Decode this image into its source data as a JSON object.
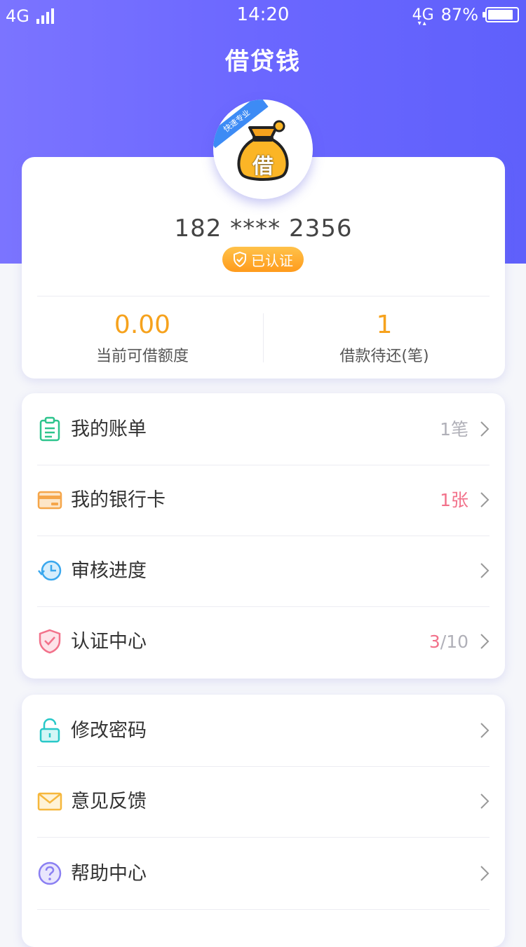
{
  "status_bar": {
    "network_left": "4G",
    "time": "14:20",
    "network_right": "4G",
    "battery": "87%",
    "battery_level": 0.87
  },
  "header": {
    "title": "借贷钱"
  },
  "profile": {
    "avatar_ribbon": "快速专业",
    "avatar_icon": "money-bag-icon",
    "avatar_char": "借",
    "phone": "182 **** 2356",
    "verified_label": "已认证",
    "stats": [
      {
        "value": "0.00",
        "label": "当前可借额度"
      },
      {
        "value": "1",
        "label": "借款待还(笔)"
      }
    ]
  },
  "menu_group_1": [
    {
      "label": "我的账单",
      "value": "1笔",
      "icon": "clipboard-icon",
      "color": "#2dc48d"
    },
    {
      "label": "我的银行卡",
      "value": "1张",
      "icon": "bank-card-icon",
      "color": "#f5a64a"
    },
    {
      "label": "审核进度",
      "value": "",
      "icon": "clock-progress-icon",
      "color": "#3aa8ee"
    },
    {
      "label": "认证中心",
      "value_done": "3",
      "value_total": "/10",
      "icon": "shield-check-icon",
      "color": "#f2718a"
    }
  ],
  "menu_group_2": [
    {
      "label": "修改密码",
      "icon": "lock-icon",
      "color": "#28c8c8"
    },
    {
      "label": "意见反馈",
      "icon": "envelope-icon",
      "color": "#f6b73c"
    },
    {
      "label": "帮助中心",
      "icon": "help-icon",
      "color": "#8a7ff2"
    }
  ],
  "colors": {
    "header_gradient_start": "#7b74ff",
    "header_gradient_end": "#5f60fb",
    "accent_orange": "#f6a21d",
    "accent_pink": "#f2718a",
    "muted_gray": "#b0b0b8"
  }
}
